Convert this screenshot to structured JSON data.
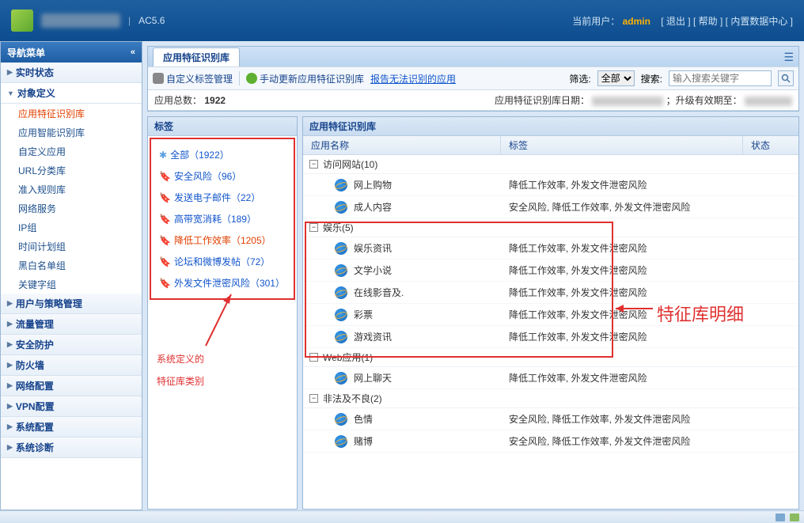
{
  "header": {
    "version": "AC5.6",
    "user_label": "当前用户：",
    "user_name": "admin",
    "logout": "[ 退出 ]",
    "help": "[ 帮助 ]",
    "data_center": "[  内置数据中心 ]"
  },
  "nav": {
    "title": "导航菜单",
    "items": [
      {
        "label": "实时状态",
        "expanded": false
      },
      {
        "label": "对象定义",
        "expanded": true,
        "subs": [
          {
            "label": "应用特征识别库",
            "active": true
          },
          {
            "label": "应用智能识别库"
          },
          {
            "label": "自定义应用"
          },
          {
            "label": "URL分类库"
          },
          {
            "label": "准入规则库"
          },
          {
            "label": "网络服务"
          },
          {
            "label": "IP组"
          },
          {
            "label": "时间计划组"
          },
          {
            "label": "黑白名单组"
          },
          {
            "label": "关键字组"
          }
        ]
      },
      {
        "label": "用户与策略管理"
      },
      {
        "label": "流量管理"
      },
      {
        "label": "安全防护"
      },
      {
        "label": "防火墙"
      },
      {
        "label": "网络配置"
      },
      {
        "label": "VPN配置"
      },
      {
        "label": "系统配置"
      },
      {
        "label": "系统诊断"
      }
    ]
  },
  "main": {
    "tab_title": "应用特征识别库",
    "toolbar": {
      "custom_tags": "自定义标签管理",
      "manual_update": "手动更新应用特征识别库",
      "report_link": "报告无法识别的应用",
      "filter_label": "筛选:",
      "filter_value": "全部",
      "search_label": "搜索:",
      "search_placeholder": "输入搜索关键字"
    },
    "info": {
      "total_label": "应用总数：",
      "total": "1922",
      "lib_date_label": "应用特征识别库日期：",
      "valid_label": "；升级有效期至："
    },
    "tag_panel_title": "标签",
    "tags": [
      {
        "label": "全部（1922）",
        "star": true
      },
      {
        "label": "安全风险（96）"
      },
      {
        "label": "发送电子邮件（22）"
      },
      {
        "label": "高带宽消耗（189）"
      },
      {
        "label": "降低工作效率（1205）",
        "selected": true
      },
      {
        "label": "论坛和微博发帖（72）"
      },
      {
        "label": "外发文件泄密风险（301）"
      }
    ],
    "lib_panel_title": "应用特征识别库",
    "grid_headers": {
      "name": "应用名称",
      "tag": "标签",
      "status": "状态"
    },
    "groups": [
      {
        "name": "访问网站(10)",
        "open": true,
        "rows": [
          {
            "name": "网上购物",
            "tags": "降低工作效率, 外发文件泄密风险"
          },
          {
            "name": "成人内容",
            "tags": "安全风险, 降低工作效率, 外发文件泄密风险"
          }
        ]
      },
      {
        "name": "娱乐(5)",
        "open": true,
        "boxed": true,
        "rows": [
          {
            "name": "娱乐资讯",
            "tags": "降低工作效率, 外发文件泄密风险"
          },
          {
            "name": "文学小说",
            "tags": "降低工作效率, 外发文件泄密风险"
          },
          {
            "name": "在线影音及.",
            "tags": "降低工作效率, 外发文件泄密风险"
          },
          {
            "name": "彩票",
            "tags": "降低工作效率, 外发文件泄密风险"
          },
          {
            "name": "游戏资讯",
            "tags": "降低工作效率, 外发文件泄密风险"
          }
        ]
      },
      {
        "name": "Web应用(1)",
        "open": true,
        "rows": [
          {
            "name": "网上聊天",
            "tags": "降低工作效率, 外发文件泄密风险"
          }
        ]
      },
      {
        "name": "非法及不良(2)",
        "open": true,
        "rows": [
          {
            "name": "色情",
            "tags": "安全风险, 降低工作效率, 外发文件泄密风险"
          },
          {
            "name": "赌博",
            "tags": "安全风险, 降低工作效率, 外发文件泄密风险"
          }
        ]
      }
    ]
  },
  "annotations": {
    "left_text1": "系统定义的",
    "left_text2": "特征库类别",
    "right_text": "特征库明细"
  }
}
